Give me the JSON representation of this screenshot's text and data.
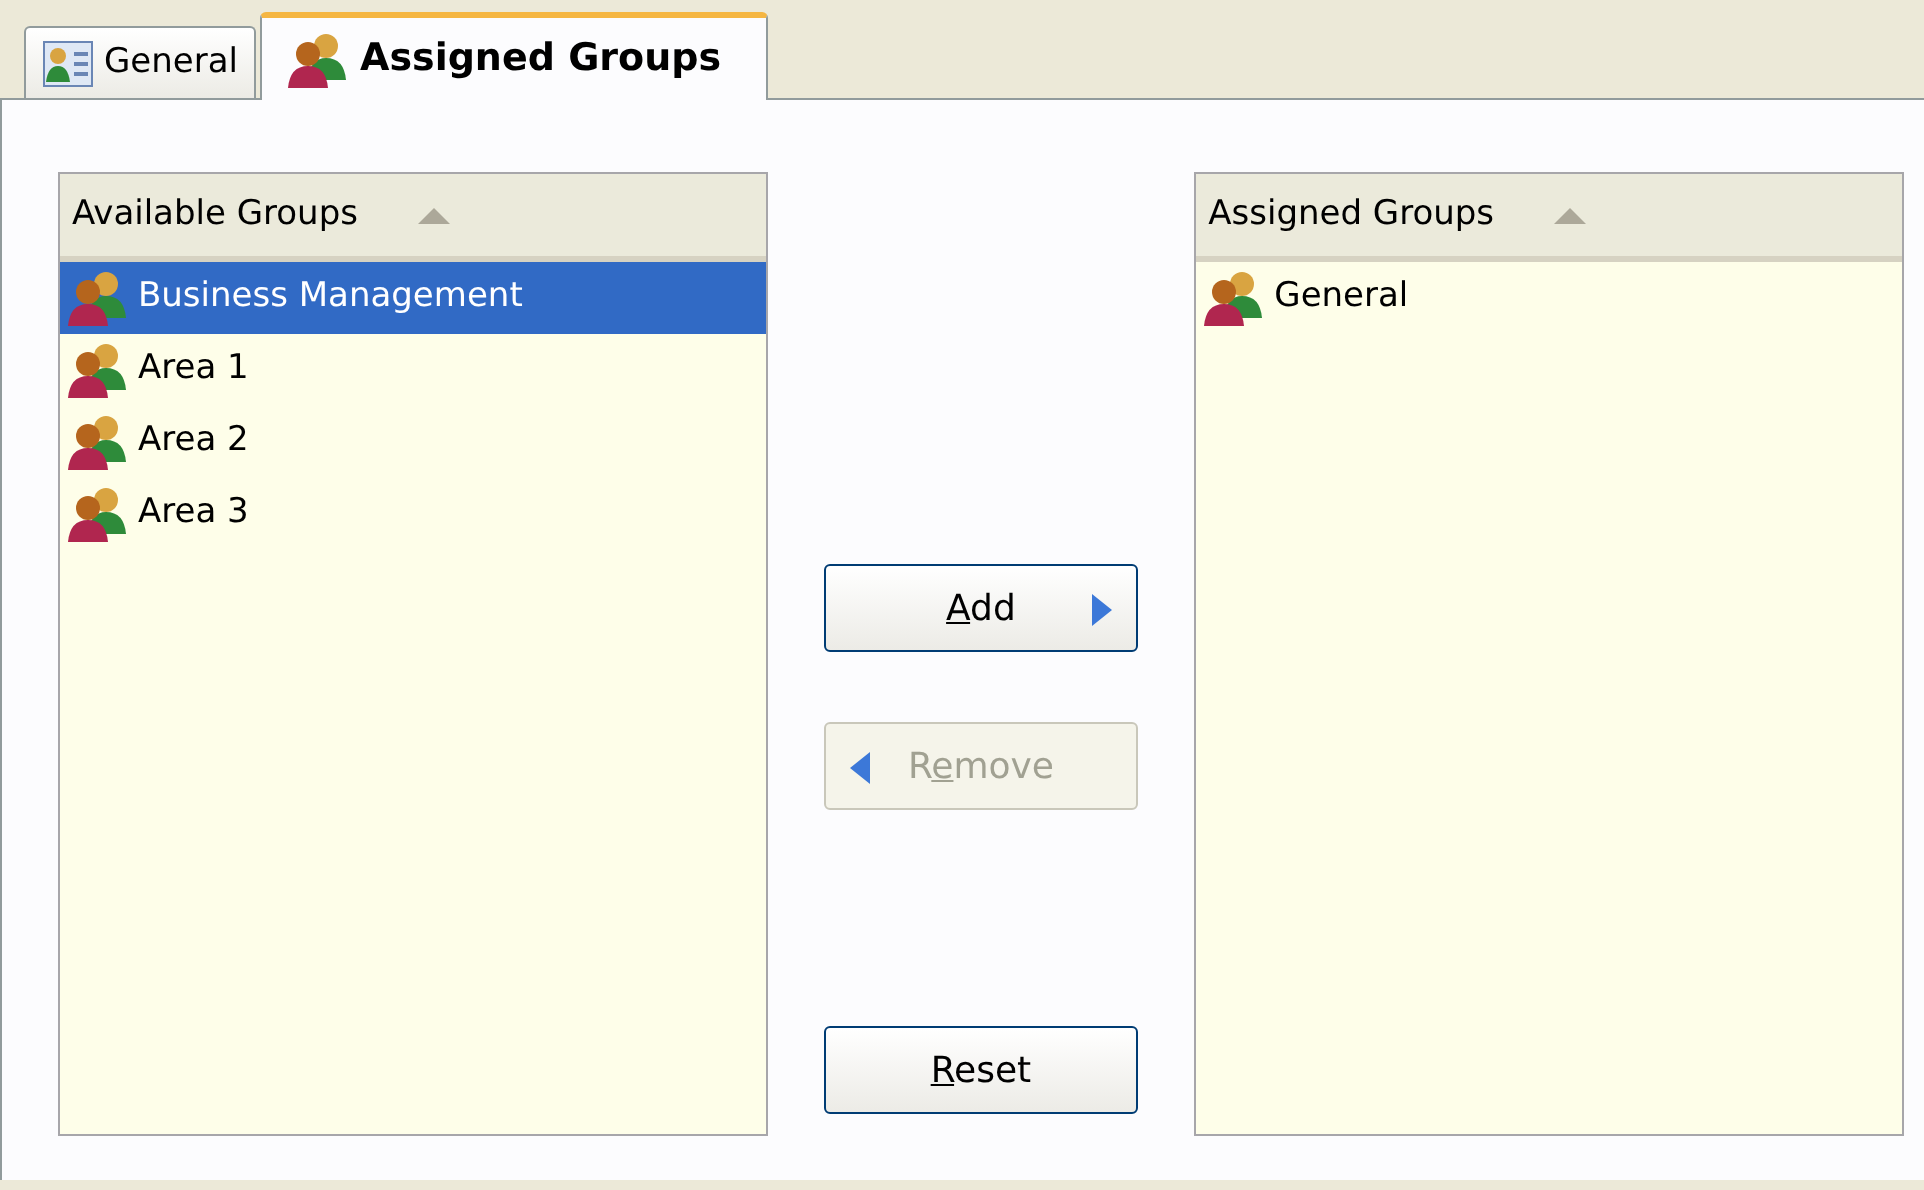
{
  "tabs": [
    {
      "label": "General",
      "kind": "card",
      "selected": false
    },
    {
      "label": "Assigned Groups",
      "kind": "group",
      "selected": true
    }
  ],
  "available": {
    "header": "Available Groups",
    "items": [
      {
        "label": "Business Management",
        "selected": true
      },
      {
        "label": "Area 1",
        "selected": false
      },
      {
        "label": "Area 2",
        "selected": false
      },
      {
        "label": "Area 3",
        "selected": false
      }
    ]
  },
  "buttons": [
    {
      "kind": "add",
      "access_key": "A",
      "label_end": "dd",
      "disabled": false
    },
    {
      "kind": "remove",
      "label_start": "R",
      "access_key": "e",
      "label_end": "move",
      "disabled": true
    },
    {
      "kind": "reset",
      "access_key": "R",
      "label_end": "eset",
      "disabled": false
    }
  ],
  "assigned": {
    "header": "Assigned Groups",
    "items": [
      {
        "label": "General",
        "selected": false
      }
    ]
  }
}
